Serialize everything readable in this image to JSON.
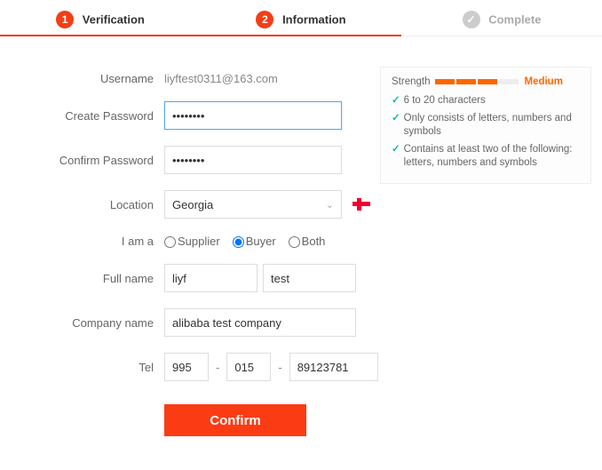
{
  "steps": {
    "s1": {
      "num": "1",
      "label": "Verification"
    },
    "s2": {
      "num": "2",
      "label": "Information"
    },
    "s3": {
      "num": "✓",
      "label": "Complete"
    }
  },
  "labels": {
    "username": "Username",
    "create_password": "Create Password",
    "confirm_password": "Confirm Password",
    "location": "Location",
    "iam": "I am a",
    "full_name": "Full name",
    "company": "Company name",
    "tel": "Tel"
  },
  "values": {
    "username": "liyftest0311@163.com",
    "password": "••••••••",
    "confirm_password": "••••••••",
    "location": "Georgia",
    "first_name": "liyf",
    "last_name": "test",
    "company": "alibaba test company",
    "tel_cc": "995",
    "tel_area": "015",
    "tel_num": "89123781"
  },
  "role_options": {
    "supplier": "Supplier",
    "buyer": "Buyer",
    "both": "Both"
  },
  "tel_sep": "-",
  "confirm": "Confirm",
  "strength": {
    "title": "Strength",
    "level": "Medium",
    "rules": {
      "r1": "6 to 20 characters",
      "r2": "Only consists of letters, numbers and symbols",
      "r3": "Contains at least two of the following: letters, numbers and symbols"
    }
  }
}
